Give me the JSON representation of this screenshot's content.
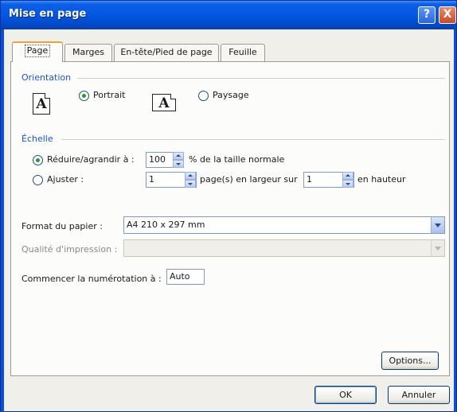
{
  "window": {
    "title": "Mise en page",
    "help_label": "?",
    "close_label": "X"
  },
  "tabs": [
    {
      "label": "Page"
    },
    {
      "label": "Marges"
    },
    {
      "label": "En-tête/Pied de page"
    },
    {
      "label": "Feuille"
    }
  ],
  "orientation": {
    "group_title": "Orientation",
    "portrait_label": "Portrait",
    "landscape_label": "Paysage",
    "selected": "Portrait",
    "icon_glyph": "A"
  },
  "scale": {
    "group_title": "Échelle",
    "reduce_label": "Réduire/agrandir à :",
    "reduce_value": "100",
    "reduce_suffix": "% de la taille normale",
    "fit_label": "Ajuster :",
    "fit_wide_value": "1",
    "fit_wide_suffix": "page(s) en largeur sur",
    "fit_tall_value": "1",
    "fit_tall_suffix": "en hauteur"
  },
  "paper": {
    "label": "Format du papier :",
    "value": "A4 210 x 297 mm"
  },
  "quality": {
    "label": "Qualité d'impression :",
    "value": ""
  },
  "first_page": {
    "label": "Commencer la numérotation à :",
    "value": "Auto"
  },
  "buttons": {
    "options": "Options...",
    "ok": "OK",
    "cancel": "Annuler"
  },
  "colors": {
    "titlebar": "#0457e0",
    "group_title": "#1a55c8",
    "radio_selected": "#21a121"
  },
  "icons": [
    "help-icon",
    "close-icon",
    "portrait-page-icon",
    "landscape-page-icon",
    "spin-icon",
    "dropdown-arrow-icon"
  ]
}
